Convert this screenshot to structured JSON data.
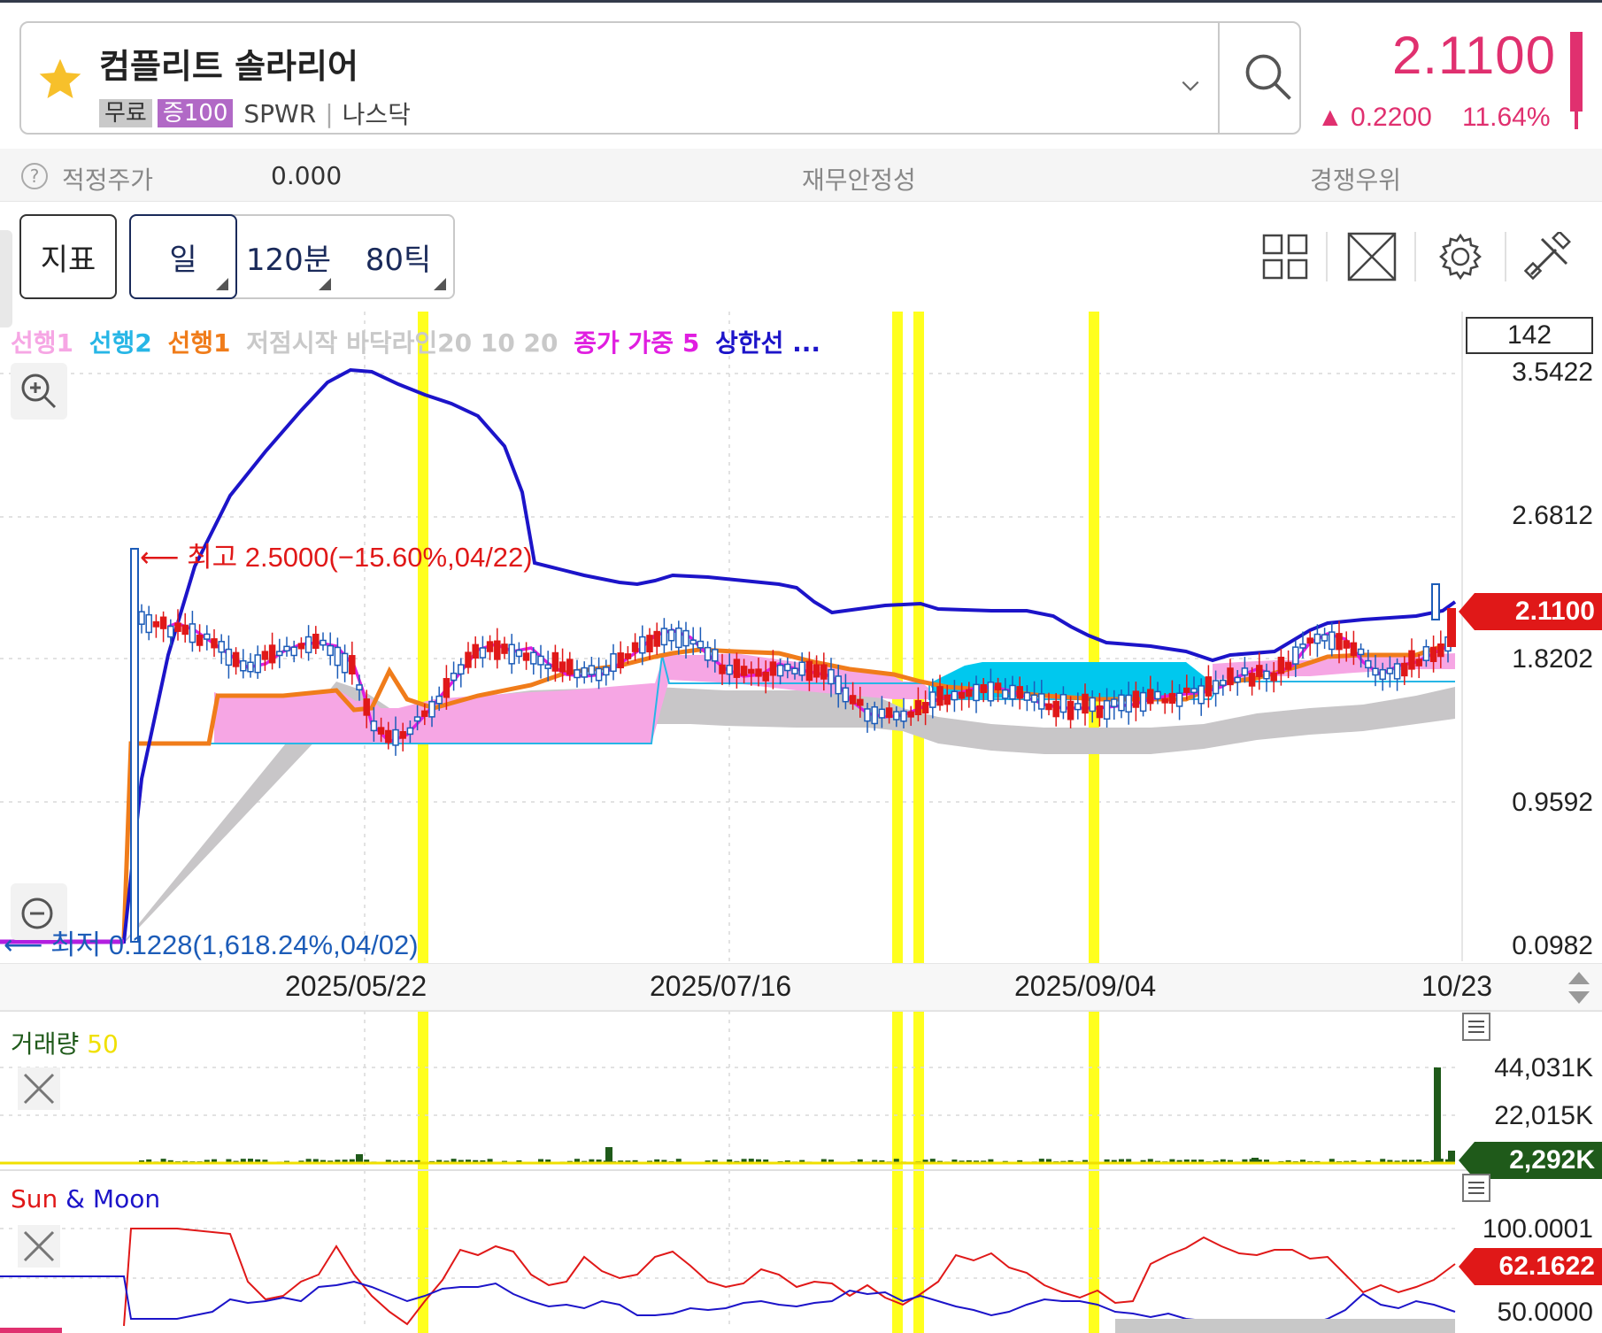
{
  "header": {
    "stock_name": "컴플리트 솔라리어",
    "tag_free": "무료",
    "tag_margin": "증100",
    "ticker": "SPWR",
    "exchange": "나스닥",
    "price": "2.1100",
    "change": "▲ 0.2200",
    "change_pct": "11.64%",
    "up_color": "#e0306f"
  },
  "valuation": {
    "fair_price_label": "적정주가",
    "fair_price_value": "0.000",
    "financial_stability_label": "재무안정성",
    "competitive_label": "경쟁우위"
  },
  "toolbar": {
    "indicator_label": "지표",
    "period_day": "일",
    "period_120m": "120분",
    "period_80tick": "80틱",
    "icons": [
      "layout-grid-icon",
      "expand-icon",
      "settings-gear-icon",
      "tools-icon"
    ]
  },
  "legend": {
    "items": [
      {
        "text": "선행1",
        "color": "#f6a6e4"
      },
      {
        "text": "선행2",
        "color": "#27b6e6"
      },
      {
        "text": "선행1",
        "color": "#f07c1a"
      },
      {
        "text": "저점시작 바닥라인20 10 20",
        "color": "#c9c9c9"
      },
      {
        "text": "종가 가중 5",
        "color": "#e01ee0"
      },
      {
        "text": "상한선 ...",
        "color": "#1c14c9"
      }
    ]
  },
  "price_axis": {
    "box_value": "142",
    "ticks": [
      "3.5422",
      "2.6812",
      "1.8202",
      "0.9592",
      "0.0982"
    ],
    "current_price": "2.1100"
  },
  "annotations": {
    "high": "최고 2.5000(−15.60%,04/22)",
    "low": "최저 0.1228(1,618.24%,04/02)"
  },
  "dates": [
    "2025/05/22",
    "2025/07/16",
    "2025/09/04",
    "10/23"
  ],
  "volume_pane": {
    "title": "거래량",
    "period": "50",
    "ticks": [
      "44,031K",
      "22,015K"
    ],
    "current": "2,292K"
  },
  "sunmoon_pane": {
    "title_sun": "Sun",
    "title_amp": "&",
    "title_moon": "Moon",
    "ticks": [
      "100.0001",
      "50.0000"
    ],
    "current": "62.1622"
  }
}
